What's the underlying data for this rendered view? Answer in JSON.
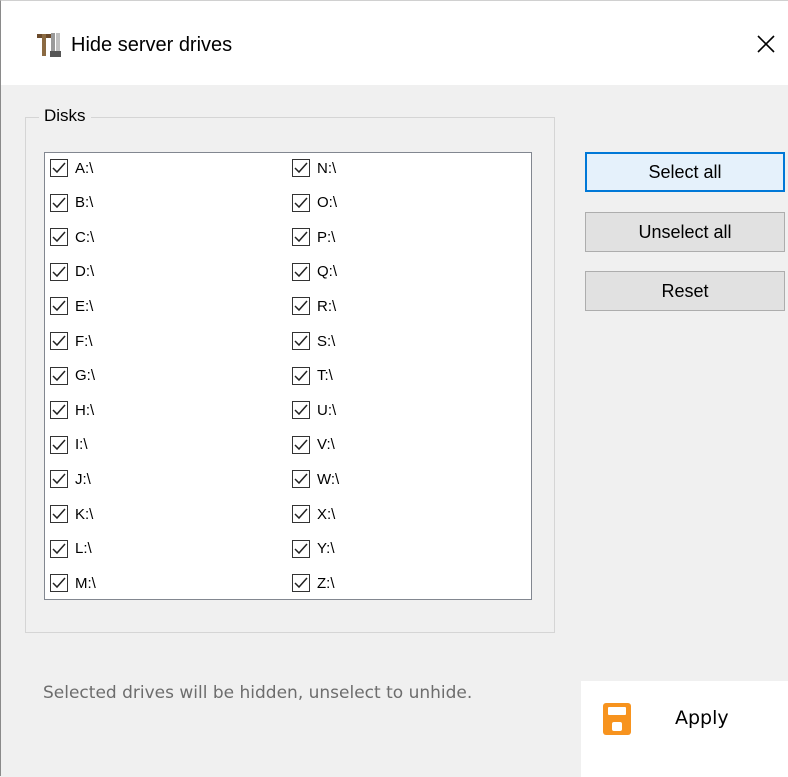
{
  "window": {
    "title": "Hide server drives"
  },
  "group": {
    "label": "Disks"
  },
  "drives": [
    {
      "label": "A:\\",
      "checked": true
    },
    {
      "label": "B:\\",
      "checked": true
    },
    {
      "label": "C:\\",
      "checked": true
    },
    {
      "label": "D:\\",
      "checked": true
    },
    {
      "label": "E:\\",
      "checked": true
    },
    {
      "label": "F:\\",
      "checked": true
    },
    {
      "label": "G:\\",
      "checked": true
    },
    {
      "label": "H:\\",
      "checked": true
    },
    {
      "label": "I:\\",
      "checked": true
    },
    {
      "label": "J:\\",
      "checked": true
    },
    {
      "label": "K:\\",
      "checked": true
    },
    {
      "label": "L:\\",
      "checked": true
    },
    {
      "label": "M:\\",
      "checked": true
    },
    {
      "label": "N:\\",
      "checked": true
    },
    {
      "label": "O:\\",
      "checked": true
    },
    {
      "label": "P:\\",
      "checked": true
    },
    {
      "label": "Q:\\",
      "checked": true
    },
    {
      "label": "R:\\",
      "checked": true
    },
    {
      "label": "S:\\",
      "checked": true
    },
    {
      "label": "T:\\",
      "checked": true
    },
    {
      "label": "U:\\",
      "checked": true
    },
    {
      "label": "V:\\",
      "checked": true
    },
    {
      "label": "W:\\",
      "checked": true
    },
    {
      "label": "X:\\",
      "checked": true
    },
    {
      "label": "Y:\\",
      "checked": true
    },
    {
      "label": "Z:\\",
      "checked": true
    }
  ],
  "buttons": {
    "select_all": "Select all",
    "unselect_all": "Unselect all",
    "reset": "Reset"
  },
  "hint": "Selected drives will be hidden, unselect to unhide.",
  "apply": {
    "label": "Apply",
    "icon": "save-icon",
    "icon_color": "#f7931e"
  },
  "colors": {
    "default_button_border": "#0078d7",
    "title_bg": "#ffffff"
  }
}
